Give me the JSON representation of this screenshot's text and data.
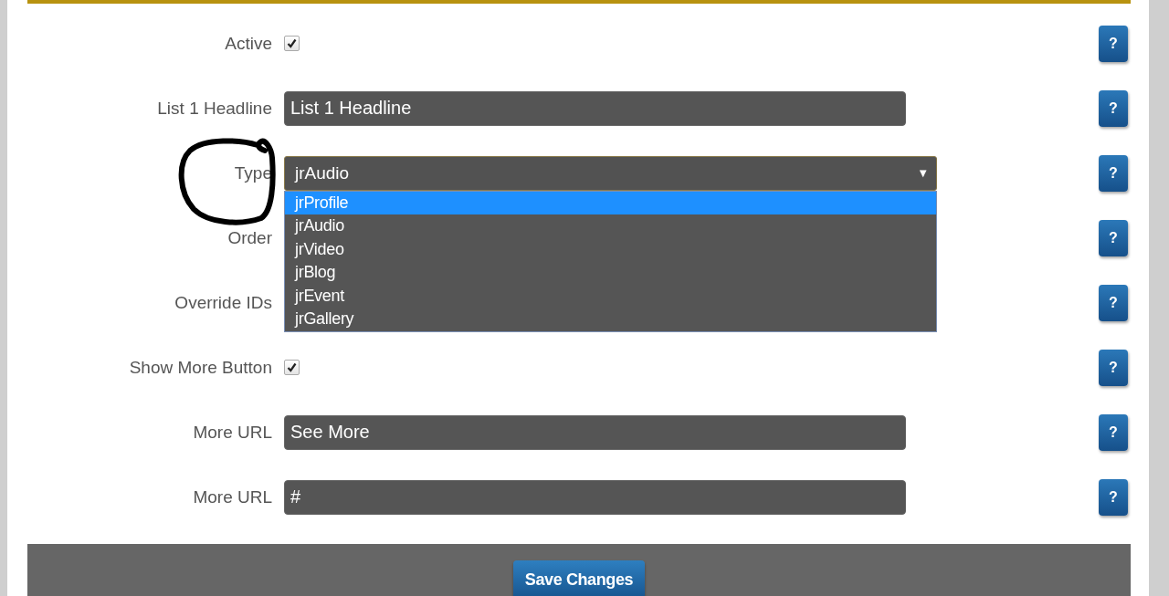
{
  "rows": [
    {
      "label": "Active",
      "kind": "checkbox",
      "checked": true,
      "help": "?"
    },
    {
      "label": "List 1 Headline",
      "kind": "text",
      "value": "List 1 Headline",
      "help": "?"
    },
    {
      "label": "Type",
      "kind": "select",
      "value": "jrAudio",
      "arrow": "▼",
      "expanded": true,
      "options": [
        {
          "label": "jrProfile",
          "highlighted": true
        },
        {
          "label": "jrAudio",
          "highlighted": false
        },
        {
          "label": "jrVideo",
          "highlighted": false
        },
        {
          "label": "jrBlog",
          "highlighted": false
        },
        {
          "label": "jrEvent",
          "highlighted": false
        },
        {
          "label": "jrGallery",
          "highlighted": false
        }
      ],
      "help": "?"
    },
    {
      "label": "Order",
      "kind": "covered",
      "help": "?"
    },
    {
      "label": "Override IDs",
      "kind": "covered",
      "help": "?"
    },
    {
      "label": "Show More Button",
      "kind": "checkbox",
      "checked": true,
      "help": "?"
    },
    {
      "label": "More URL",
      "kind": "text",
      "value": "See More",
      "help": "?"
    },
    {
      "label": "More URL",
      "kind": "text",
      "value": "#",
      "help": "?"
    }
  ],
  "save_button": "Save Changes"
}
